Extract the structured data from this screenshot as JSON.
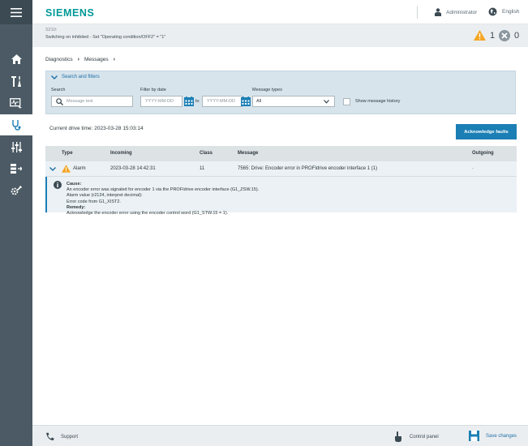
{
  "header": {
    "logo": "SIEMENS",
    "user": "Administrator",
    "language": "English"
  },
  "status": {
    "code": "S210:",
    "text": "Switching on inhibited - Set \"Operating condition/OFF2\" = \"1\"",
    "alarm_count": "1",
    "fault_count": "0"
  },
  "breadcrumb": [
    "Diagnostics",
    "Messages"
  ],
  "filters": {
    "toggle_label": "Search and filters",
    "search_label": "Search",
    "search_placeholder": "Message text",
    "date_label": "Filter by date",
    "date_from_placeholder": "YYYY-MM-DD",
    "date_to_label": "to",
    "date_to_placeholder": "YYYY-MM-DD",
    "types_label": "Message types",
    "types_value": "All",
    "history_label": "Show message history"
  },
  "drive_time": "Current drive time: 2023-03-28 15:03:14",
  "ack_button": "Acknowledge faults",
  "table": {
    "columns": [
      "Type",
      "Incoming",
      "Class",
      "Message",
      "Outgoing"
    ],
    "rows": [
      {
        "type": "Alarm",
        "incoming": "2023-03-28 14:42:31",
        "class": "11",
        "message": "7565: Drive: Encoder error in PROFIdrive encoder interface 1 (1)",
        "outgoing": "-"
      }
    ],
    "detail": {
      "cause_title": "Cause:",
      "cause_1": "An encoder error was signaled for encoder 1 via the PROFIdrive encoder interface (G1_ZSW.15).",
      "cause_2": "Alarm value (r2124, interpret decimal):",
      "cause_3": "Error code from G1_XIST2.",
      "remedy_title": "Remedy:",
      "remedy_1": "Acknowledge the encoder error using the encoder control word (G1_STW.15 = 1)."
    }
  },
  "footer": {
    "support": "Support",
    "control_panel": "Control panel",
    "save": "Save changes"
  },
  "colors": {
    "brand": "#009999",
    "accent": "#1b7fb5",
    "warning": "#f5a623",
    "sidebar": "#4b5a64"
  }
}
